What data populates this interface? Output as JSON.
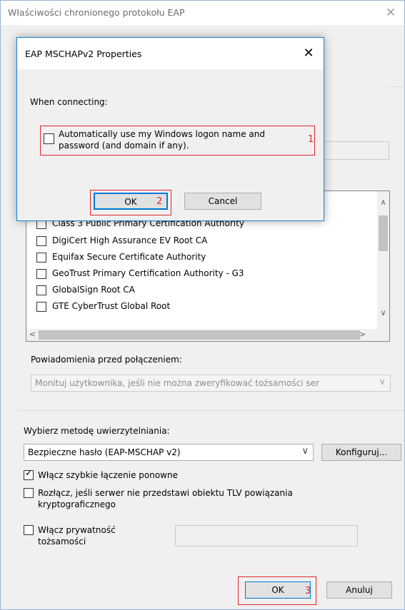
{
  "outer_dialog": {
    "title": "Właściwości chronionego protokołu EAP",
    "close_glyph": "✕",
    "certificates": [
      "Class 3 Public Primary Certification Authority",
      "DigiCert High Assurance EV Root CA",
      "Equifax Secure Certificate Authority",
      "GeoTrust Primary Certification Authority - G3",
      "GlobalSign Root CA",
      "GTE CyberTrust Global Root"
    ],
    "notify_label": "Powiadomienia przed połączeniem:",
    "notify_value": "Monituj użytkownika, jeśli nie można zweryfikować tożsamości ser",
    "auth_method_label": "Wybierz metodę uwierzytelniania:",
    "auth_method_value": "Bezpieczne hasło (EAP-MSCHAP v2)",
    "configure_button": "Konfiguruj...",
    "fast_reconnect_label": "Włącz szybkie łączenie ponowne",
    "fast_reconnect_checked": true,
    "disconnect_label_line1": "Rozłącz, jeśli serwer nie przedstawi obiektu TLV powiązania",
    "disconnect_label_line2": "kryptograficznego",
    "disconnect_checked": false,
    "privacy_label_line1": "Włącz prywatność",
    "privacy_label_line2": "tożsamości",
    "privacy_checked": false,
    "ok_button": "OK",
    "cancel_button": "Anuluj",
    "annotation_ok": "3"
  },
  "inner_dialog": {
    "title": "EAP MSCHAPv2 Properties",
    "close_glyph": "✕",
    "when_connecting": "When connecting:",
    "auto_logon_line1": "Automatically use my Windows logon name and",
    "auto_logon_line2": "password (and domain if any).",
    "auto_logon_checked": false,
    "annotation_checkbox": "1",
    "ok_button": "OK",
    "annotation_ok": "2",
    "cancel_button": "Cancel"
  },
  "colors": {
    "annotation_red": "#e0262a",
    "focus_blue": "#0078d7",
    "dialog_bg": "#f0f0f0"
  },
  "icons": {
    "scroll_up": "∧",
    "scroll_down": "∨",
    "scroll_left": "<",
    "scroll_right": ">",
    "dropdown": "∨",
    "checkmark": "✓"
  }
}
